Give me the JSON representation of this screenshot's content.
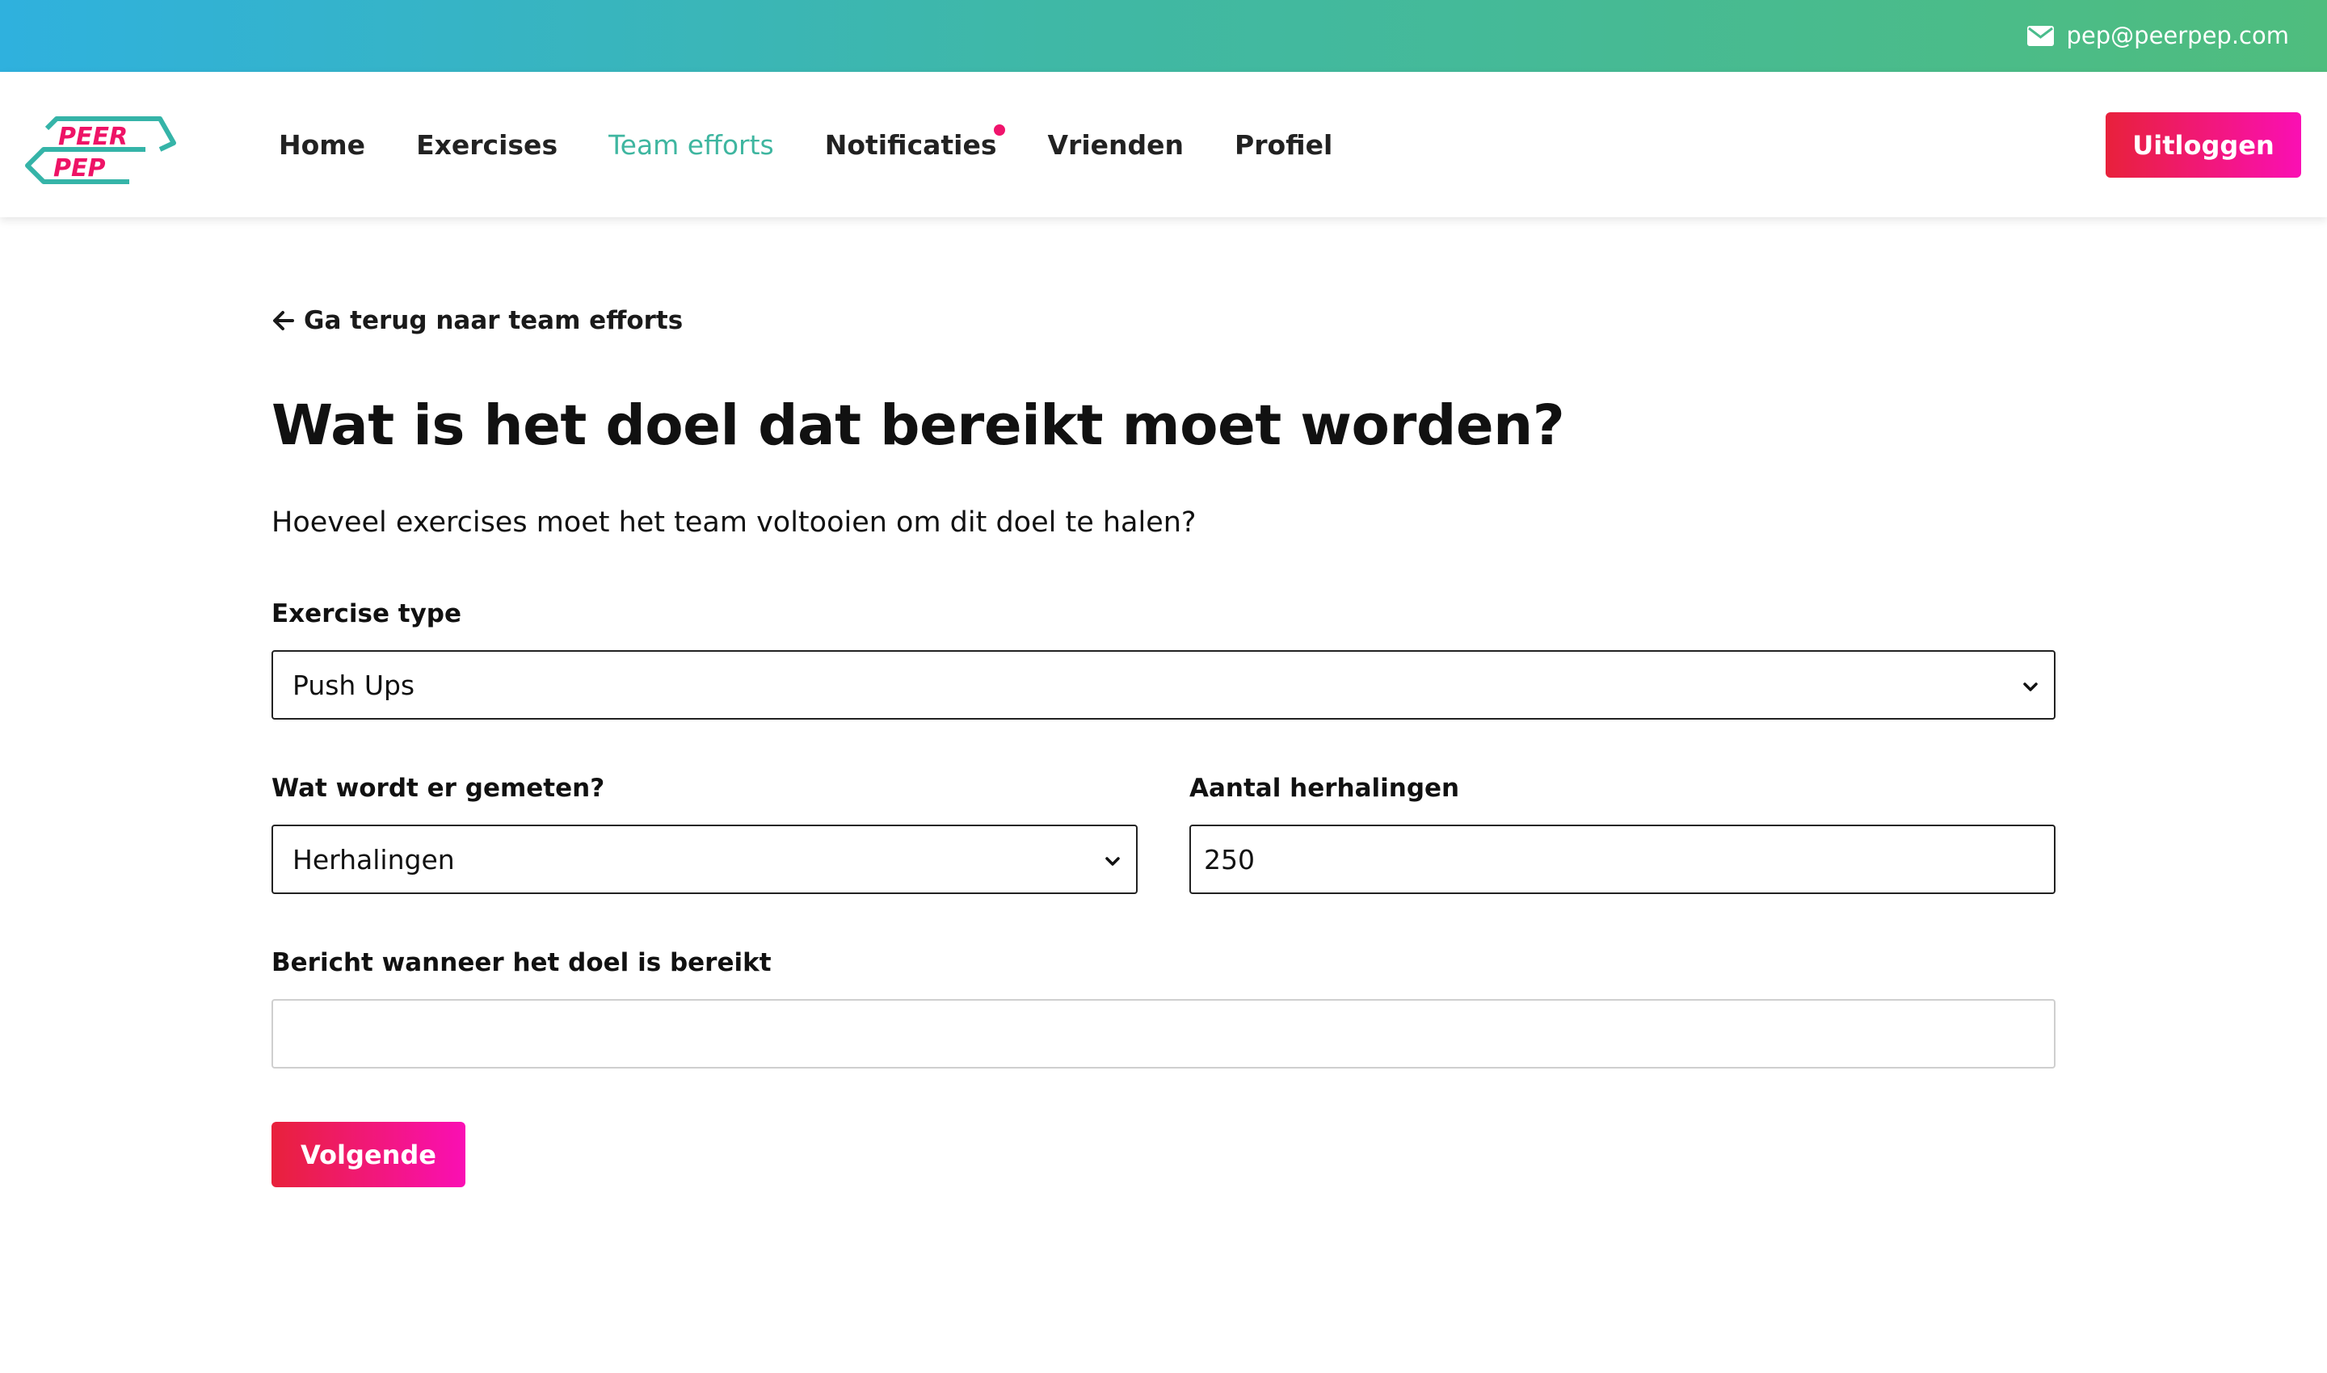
{
  "topbar": {
    "email": "pep@peerpep.com",
    "mail_icon": "envelope-icon"
  },
  "brand": {
    "logo_line1": "PEER",
    "logo_line2": "PEP",
    "colors": {
      "teal": "#35b4a8",
      "pink": "#ee1366"
    }
  },
  "nav": {
    "items": [
      {
        "label": "Home",
        "active": false
      },
      {
        "label": "Exercises",
        "active": false
      },
      {
        "label": "Team efforts",
        "active": true
      },
      {
        "label": "Notificaties",
        "active": false,
        "has_notification_dot": true
      },
      {
        "label": "Vrienden",
        "active": false
      },
      {
        "label": "Profiel",
        "active": false
      }
    ],
    "logout_label": "Uitloggen"
  },
  "main": {
    "back_link": "Ga terug naar team efforts",
    "title": "Wat is het doel dat bereikt moet worden?",
    "subtitle": "Hoeveel exercises moet het team voltooien om dit doel te halen?",
    "exercise_type": {
      "label": "Exercise type",
      "value": "Push Ups"
    },
    "measured": {
      "label": "Wat wordt er gemeten?",
      "value": "Herhalingen"
    },
    "repetitions": {
      "label": "Aantal herhalingen",
      "value": "250"
    },
    "message": {
      "label": "Bericht wanneer het doel is bereikt",
      "value": ""
    },
    "next_label": "Volgende"
  },
  "colors": {
    "accent_gradient_start": "#e8213b",
    "accent_gradient_end": "#fa0fb4",
    "active_nav": "#3fb6a0",
    "topbar_start": "#2fb1de",
    "topbar_end": "#4fbd7e"
  }
}
